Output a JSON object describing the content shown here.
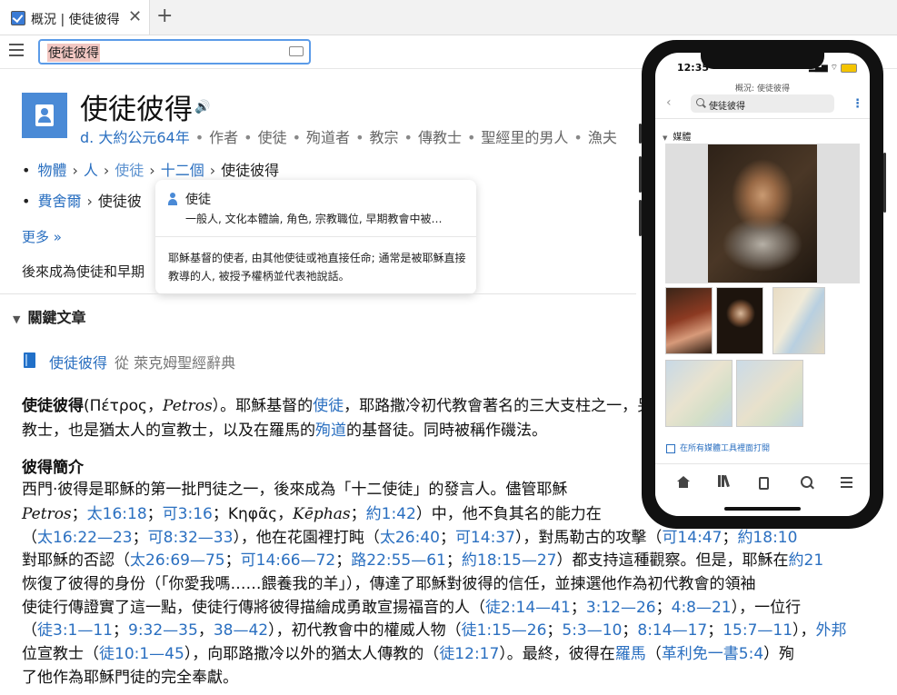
{
  "tab": {
    "title": "概況 | 使徒彼得",
    "close": "✕",
    "new_tab": "+"
  },
  "search": {
    "value": "使徒彼得"
  },
  "header": {
    "title": "使徒彼得",
    "meta_date": "d. 大約公元64年",
    "meta_tags": [
      "作者",
      "使徒",
      "殉道者",
      "教宗",
      "傳教士",
      "聖經里的男人",
      "漁夫"
    ]
  },
  "breadcrumb1": [
    "物體",
    "人",
    "使徒",
    "十二個",
    "使徒彼得"
  ],
  "breadcrumb2": [
    "費舍爾",
    "使徒彼"
  ],
  "more_label": "更多 »",
  "summary_text": "後來成為使徒和早期",
  "popover": {
    "title": "使徒",
    "subtitle": "一般人, 文化本體論, 角色, 宗教職位, 早期教會中被…",
    "description": "耶穌基督的使者, 由其他使徒或祂直接任命; 通常是被耶穌直接教導的人, 被授予權柄並代表祂說話。"
  },
  "section": {
    "title": "關鍵文章"
  },
  "article": {
    "link": "使徒彼得",
    "source": "從 萊克姆聖經辭典",
    "line1a": "使徒彼得",
    "line1b": "(Πέτρος，",
    "line1c": "Petros",
    "line1d": "）。耶穌基督的",
    "line1e": "使徒",
    "line1f": "，耶路撒冷初代教會著名的三大支柱之一，另一位",
    "line2a": "教士，也是猶太人的宣教士，以及在羅馬的",
    "line2b": "殉道",
    "line2c": "的基督徒。同時被稱作磯法。",
    "subhead": "彼得簡介",
    "p1": "西門·彼得是耶穌的第一批門徒之一，後來成為「十二使徒」的發言人。儘管耶穌",
    "p2": [
      {
        "t": "Petros",
        "i": true
      },
      {
        "t": "；"
      },
      {
        "t": "太16:18",
        "l": true
      },
      {
        "t": "；"
      },
      {
        "t": "可3:16",
        "l": true
      },
      {
        "t": "；Κηφᾶς，"
      },
      {
        "t": "Kēphas",
        "i": true
      },
      {
        "t": "；"
      },
      {
        "t": "約1:42",
        "l": true
      },
      {
        "t": "）中，他不負其名的能力在"
      }
    ],
    "p3": [
      {
        "t": "（"
      },
      {
        "t": "太16:22—23",
        "l": true
      },
      {
        "t": "；"
      },
      {
        "t": "可8:32—33",
        "l": true
      },
      {
        "t": "），他在花園裡打盹（"
      },
      {
        "t": "太26:40",
        "l": true
      },
      {
        "t": "；"
      },
      {
        "t": "可14:37",
        "l": true
      },
      {
        "t": "），對馬勒古的攻擊（"
      },
      {
        "t": "可14:47",
        "l": true
      },
      {
        "t": "；"
      },
      {
        "t": "約18:10",
        "l": true
      }
    ],
    "p4": [
      {
        "t": "對耶穌的否認（"
      },
      {
        "t": "太26:69—75",
        "l": true
      },
      {
        "t": "；"
      },
      {
        "t": "可14:66—72",
        "l": true
      },
      {
        "t": "；"
      },
      {
        "t": "路22:55—61",
        "l": true
      },
      {
        "t": "；"
      },
      {
        "t": "約18:15—27",
        "l": true
      },
      {
        "t": "）都支持這種觀察。但是，耶穌在"
      },
      {
        "t": "約21",
        "l": true
      }
    ],
    "p5": "恢復了彼得的身份（「你愛我嗎……餵養我的羊」），傳達了耶穌對彼得的信任，並揀選他作為初代教會的領袖",
    "p6": [
      {
        "t": "使徒行傳證實了這一點，使徒行傳將彼得描繪成勇敢宣揚福音的人（"
      },
      {
        "t": "徒2:14—41",
        "l": true
      },
      {
        "t": "；"
      },
      {
        "t": "3:12—26",
        "l": true
      },
      {
        "t": "；"
      },
      {
        "t": "4:8—21",
        "l": true
      },
      {
        "t": "），一位行"
      }
    ],
    "p7": [
      {
        "t": "（"
      },
      {
        "t": "徒3:1—11",
        "l": true
      },
      {
        "t": "；"
      },
      {
        "t": "9:32—35",
        "l": true
      },
      {
        "t": "，"
      },
      {
        "t": "38—42",
        "l": true
      },
      {
        "t": "），初代教會中的權威人物（"
      },
      {
        "t": "徒1:15—26",
        "l": true
      },
      {
        "t": "；"
      },
      {
        "t": "5:3—10",
        "l": true
      },
      {
        "t": "；"
      },
      {
        "t": "8:14—17",
        "l": true
      },
      {
        "t": "；"
      },
      {
        "t": "15:7—11",
        "l": true
      },
      {
        "t": "），"
      },
      {
        "t": "外邦",
        "l": true
      }
    ],
    "p8": [
      {
        "t": "位宣教士（"
      },
      {
        "t": "徒10:1—45",
        "l": true
      },
      {
        "t": "），向耶路撒冷以外的猶太人傳教的（"
      },
      {
        "t": "徒12:17",
        "l": true
      },
      {
        "t": "）。最終，彼得在"
      },
      {
        "t": "羅馬",
        "l": true
      },
      {
        "t": "（"
      },
      {
        "t": "革利免一書5:4",
        "l": true
      },
      {
        "t": "）殉"
      }
    ],
    "p9": "了他作為耶穌門徒的完全奉獻。"
  },
  "phone": {
    "time": "12:35",
    "status_icons": "▂▄▆ ⌔",
    "page_title": "概況: 使徒彼得",
    "search_value": "使徒彼得",
    "section_title": "媒體",
    "open_link": "在所有媒體工具裡面打開"
  },
  "colors": {
    "link": "#2a6fc0",
    "accent": "#4a8ad6",
    "search_border": "#5b9be8",
    "highlight": "#f2c7c2"
  },
  "icons": [
    "checkbox-tab-icon",
    "close-icon",
    "plus-icon",
    "hamburger-icon",
    "keyboard-icon",
    "person-icon",
    "speaker-icon",
    "book-icon",
    "home-icon",
    "library-icon",
    "documents-icon",
    "search-icon",
    "menu-icon"
  ]
}
